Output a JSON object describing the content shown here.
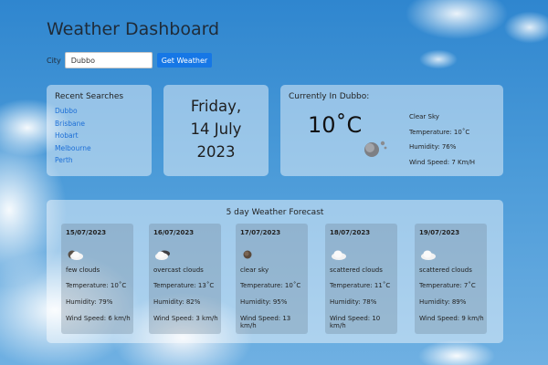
{
  "header": {
    "title": "Weather Dashboard"
  },
  "search": {
    "label": "City",
    "value": "Dubbo",
    "button_label": "Get Weather"
  },
  "recent": {
    "title": "Recent Searches",
    "items": [
      "Dubbo",
      "Brisbane",
      "Hobart",
      "Melbourne",
      "Perth"
    ]
  },
  "date": {
    "line1": "Friday,",
    "line2": "14 July",
    "line3": "2023"
  },
  "current": {
    "heading": "Currently In Dubbo:",
    "temp": "10˚C",
    "icon": "clear-sky-icon",
    "description": "Clear Sky",
    "temperature": "Temperature: 10˚C",
    "humidity": "Humidity: 76%",
    "wind": "Wind Speed: 7 Km/H"
  },
  "forecast": {
    "title": "5 day Weather Forecast",
    "days": [
      {
        "date": "15/07/2023",
        "icon": "overcast-clouds-icon",
        "description": "few clouds",
        "temperature": "Temperature: 10˚C",
        "humidity": "Humidity: 79%",
        "wind": "Wind Speed: 6 km/h"
      },
      {
        "date": "16/07/2023",
        "icon": "overcast-clouds-icon",
        "description": "overcast clouds",
        "temperature": "Temperature: 13˚C",
        "humidity": "Humidity: 82%",
        "wind": "Wind Speed: 3 km/h"
      },
      {
        "date": "17/07/2023",
        "icon": "clear-sky-icon",
        "description": "clear sky",
        "temperature": "Temperature: 10˚C",
        "humidity": "Humidity: 95%",
        "wind": "Wind Speed: 13 km/h"
      },
      {
        "date": "18/07/2023",
        "icon": "scattered-clouds-icon",
        "description": "scattered clouds",
        "temperature": "Temperature: 11˚C",
        "humidity": "Humidity: 78%",
        "wind": "Wind Speed: 10 km/h"
      },
      {
        "date": "19/07/2023",
        "icon": "scattered-clouds-icon",
        "description": "scattered clouds",
        "temperature": "Temperature: 7˚C",
        "humidity": "Humidity: 89%",
        "wind": "Wind Speed: 9 km/h"
      }
    ]
  }
}
